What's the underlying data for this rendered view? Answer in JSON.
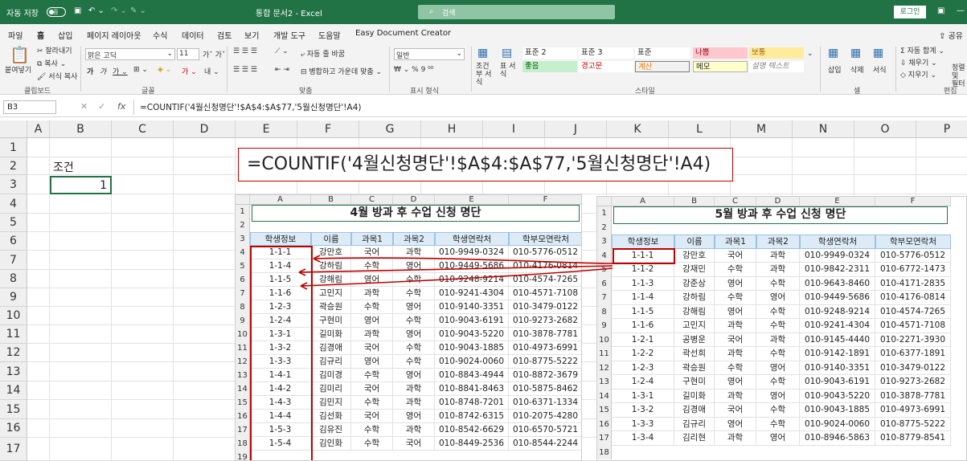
{
  "titlebar": {
    "autosave": "자동 저장",
    "autosave_state": "끔",
    "doc_title": "통합 문서2 - Excel",
    "search_placeholder": "검색",
    "login": "로그인"
  },
  "menu": [
    "파일",
    "홈",
    "삽입",
    "페이지 레이아웃",
    "수식",
    "데이터",
    "검토",
    "보기",
    "개발 도구",
    "도움말",
    "Easy Document Creator"
  ],
  "share": "공유",
  "ribbon": {
    "clipboard": {
      "paste": "붙여넣기",
      "cut": "잘라내기",
      "copy": "복사",
      "format_painter": "서식 복사",
      "group": "클립보드"
    },
    "font": {
      "name": "맑은 고딕",
      "size": "11",
      "group": "글꼴"
    },
    "align": {
      "wrap": "자동 줄 바꿈",
      "merge": "병합하고 가운데 맞춤",
      "group": "맞춤"
    },
    "number": {
      "format": "일반",
      "group": "표시 형식"
    },
    "styles": {
      "cond": "조건부 서식",
      "table": "표 서식",
      "normal2": "표준 2",
      "normal3": "표준 3",
      "normal": "표준",
      "bad": "나쁨",
      "neutral": "보통",
      "good": "좋음",
      "warning": "경고문",
      "calc": "계산",
      "note": "메모",
      "explain": "설명 텍스트",
      "group": "스타일"
    },
    "cells": {
      "insert": "삽입",
      "delete": "삭제",
      "format": "서식",
      "group": "셀"
    },
    "editing": {
      "autosum": "자동 합계",
      "fill": "채우기",
      "clear": "지우기",
      "sort": "정렬 및 필터",
      "group": "편집"
    }
  },
  "formula_bar": {
    "namebox": "B3",
    "fx": "fx",
    "formula": "=COUNTIF('4월신청명단'!$A$4:$A$77,'5월신청명단'!A4)"
  },
  "columns": [
    "A",
    "B",
    "C",
    "D",
    "E",
    "F",
    "G",
    "H",
    "I",
    "J",
    "K",
    "L",
    "M",
    "N",
    "O",
    "P"
  ],
  "rows": [
    "1",
    "2",
    "3",
    "4",
    "5",
    "6",
    "7",
    "8",
    "9",
    "10",
    "11",
    "12",
    "13",
    "14",
    "15",
    "16",
    "17"
  ],
  "cells": {
    "B2": "조건",
    "B3": "1"
  },
  "big_formula": "=COUNTIF('4월신청명단'!$A$4:$A$77,'5월신청명단'!A4)",
  "april": {
    "cols": [
      "A",
      "B",
      "C",
      "D",
      "E",
      "F"
    ],
    "title": "4월 방과 후 수업 신청 명단",
    "headers": [
      "학생정보",
      "이름",
      "과목1",
      "과목2",
      "학생연락처",
      "학부모연락처"
    ],
    "rownums": [
      "1",
      "2",
      "3",
      "4",
      "5",
      "6",
      "7",
      "8",
      "9",
      "10",
      "11",
      "12",
      "13",
      "14",
      "15",
      "16",
      "17",
      "18",
      "19"
    ],
    "rows": [
      [
        "1-1-1",
        "강만호",
        "국어",
        "과학",
        "010-9949-0324",
        "010-5776-0512"
      ],
      [
        "1-1-4",
        "강하림",
        "수학",
        "영어",
        "010-9449-5686",
        "010-4176-0814"
      ],
      [
        "1-1-5",
        "강해림",
        "영어",
        "수학",
        "010-9248-9214",
        "010-4574-7265"
      ],
      [
        "1-1-6",
        "고민지",
        "과학",
        "수학",
        "010-9241-4304",
        "010-4571-7108"
      ],
      [
        "1-2-3",
        "곽승원",
        "수학",
        "영어",
        "010-9140-3351",
        "010-3479-0122"
      ],
      [
        "1-2-4",
        "구현미",
        "영어",
        "수학",
        "010-9043-6191",
        "010-9273-2682"
      ],
      [
        "1-3-1",
        "길미화",
        "과학",
        "영어",
        "010-9043-5220",
        "010-3878-7781"
      ],
      [
        "1-3-2",
        "김경애",
        "국어",
        "수학",
        "010-9043-1885",
        "010-4973-6991"
      ],
      [
        "1-3-3",
        "김규리",
        "영어",
        "수학",
        "010-9024-0060",
        "010-8775-5222"
      ],
      [
        "1-4-1",
        "김미경",
        "수학",
        "영어",
        "010-8843-4944",
        "010-8872-3679"
      ],
      [
        "1-4-2",
        "김미리",
        "국어",
        "과학",
        "010-8841-8463",
        "010-5875-8462"
      ],
      [
        "1-4-3",
        "김민지",
        "수학",
        "과학",
        "010-8748-7201",
        "010-6371-1334"
      ],
      [
        "1-4-4",
        "김선화",
        "국어",
        "영어",
        "010-8742-6315",
        "010-2075-4280"
      ],
      [
        "1-5-3",
        "김유진",
        "수학",
        "과학",
        "010-8542-6629",
        "010-6570-5721"
      ],
      [
        "1-5-4",
        "김인화",
        "수학",
        "국어",
        "010-8449-2536",
        "010-8544-2244"
      ]
    ]
  },
  "may": {
    "cols": [
      "A",
      "B",
      "C",
      "D",
      "E",
      "F"
    ],
    "title": "5월 방과 후 수업 신청 명단",
    "headers": [
      "학생정보",
      "이름",
      "과목1",
      "과목2",
      "학생연락처",
      "학부모연락처"
    ],
    "rownums": [
      "1",
      "2",
      "3",
      "4",
      "5",
      "6",
      "7",
      "8",
      "9",
      "10",
      "11",
      "12",
      "13",
      "14",
      "15",
      "16",
      "17",
      "18"
    ],
    "rows": [
      [
        "1-1-1",
        "강만호",
        "국어",
        "과학",
        "010-9949-0324",
        "010-5776-0512"
      ],
      [
        "1-1-2",
        "강재민",
        "수학",
        "과학",
        "010-9842-2311",
        "010-6772-1473"
      ],
      [
        "1-1-3",
        "강준상",
        "영어",
        "수학",
        "010-9643-8460",
        "010-4171-2835"
      ],
      [
        "1-1-4",
        "강하림",
        "수학",
        "영어",
        "010-9449-5686",
        "010-4176-0814"
      ],
      [
        "1-1-5",
        "강해림",
        "영어",
        "수학",
        "010-9248-9214",
        "010-4574-7265"
      ],
      [
        "1-1-6",
        "고민지",
        "과학",
        "수학",
        "010-9241-4304",
        "010-4571-7108"
      ],
      [
        "1-2-1",
        "공병운",
        "국어",
        "과학",
        "010-9145-4440",
        "010-2271-3930"
      ],
      [
        "1-2-2",
        "곽선희",
        "과학",
        "수학",
        "010-9142-1891",
        "010-6377-1891"
      ],
      [
        "1-2-3",
        "곽승원",
        "수학",
        "영어",
        "010-9140-3351",
        "010-3479-0122"
      ],
      [
        "1-2-4",
        "구현미",
        "영어",
        "수학",
        "010-9043-6191",
        "010-9273-2682"
      ],
      [
        "1-3-1",
        "길미화",
        "과학",
        "영어",
        "010-9043-5220",
        "010-3878-7781"
      ],
      [
        "1-3-2",
        "김경애",
        "국어",
        "수학",
        "010-9043-1885",
        "010-4973-6991"
      ],
      [
        "1-3-3",
        "김규리",
        "영어",
        "수학",
        "010-9024-0060",
        "010-8775-5222"
      ],
      [
        "1-3-4",
        "김리현",
        "과학",
        "영어",
        "010-8946-5863",
        "010-8779-8541"
      ]
    ]
  }
}
